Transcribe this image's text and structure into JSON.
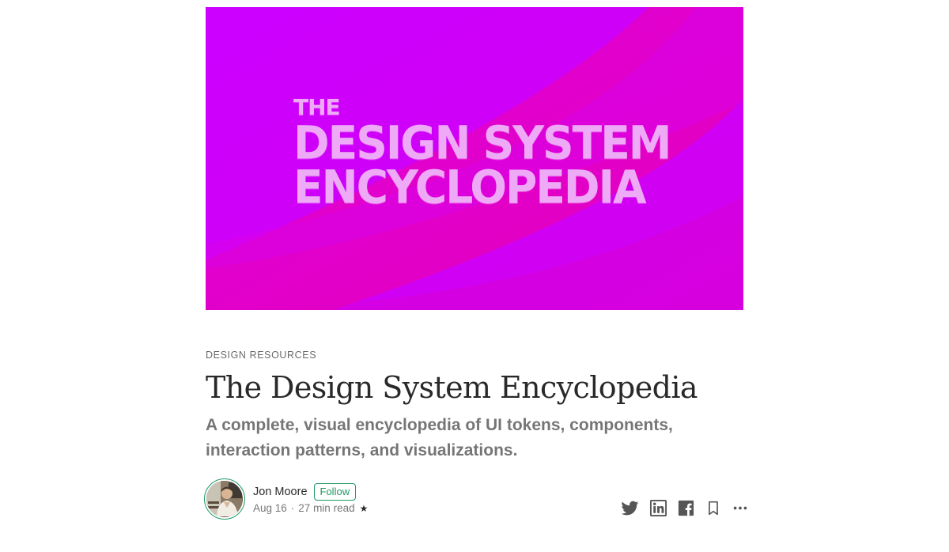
{
  "hero": {
    "line1": "THE",
    "line2": "DESIGN SYSTEM",
    "line3": "ENCYCLOPEDIA",
    "colors": {
      "base": "#d000f3",
      "accent": "#e800b8",
      "text": "#eeaaf6"
    }
  },
  "article": {
    "kicker": "DESIGN RESOURCES",
    "title": "The Design System Encyclopedia",
    "subtitle": "A complete, visual encyclopedia of UI tokens, components, interaction patterns, and visualizations."
  },
  "byline": {
    "author": "Jon Moore",
    "follow_label": "Follow",
    "date": "Aug 16",
    "separator": "·",
    "read_time": "27 min read",
    "member_badge": "★",
    "accent_color": "#1c9963"
  },
  "actions": {
    "icons": [
      "twitter-icon",
      "linkedin-icon",
      "facebook-icon",
      "bookmark-icon",
      "more-icon"
    ]
  }
}
